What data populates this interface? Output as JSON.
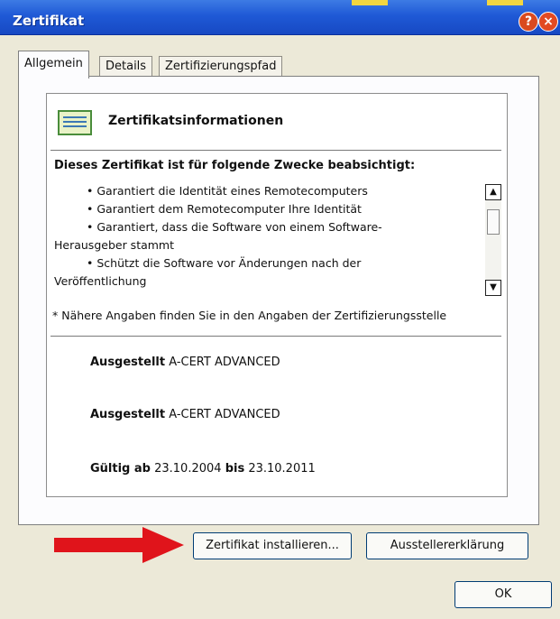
{
  "window": {
    "title": "Zertifikat",
    "help_label": "?",
    "close_label": "×"
  },
  "tabs": [
    {
      "label": "Allgemein",
      "active": true
    },
    {
      "label": "Details",
      "active": false
    },
    {
      "label": "Zertifizierungspfad",
      "active": false
    }
  ],
  "cert": {
    "title": "Zertifikatsinformationen",
    "purpose_heading": "Dieses Zertifikat ist für folgende Zwecke beabsichtigt:",
    "purposes": [
      "• Garantiert die Identität eines Remotecomputers",
      "• Garantiert dem Remotecomputer Ihre Identität",
      "• Garantiert, dass die Software von einem Software-",
      "Herausgeber stammt",
      "• Schützt die Software vor Änderungen nach der",
      "Veröffentlichung"
    ],
    "note": "* Nähere Angaben finden Sie in den Angaben der Zertifizierungsstelle",
    "issued_to_label": "Ausgestellt",
    "issued_to_value": "A-CERT ADVANCED",
    "issued_by_label": "Ausgestellt",
    "issued_by_value": "A-CERT ADVANCED",
    "valid_from_label": "Gültig ab",
    "valid_from": "23.10.2004",
    "valid_to_label": "bis",
    "valid_to": "23.10.2011"
  },
  "scrollbar": {
    "up_icon": "▲",
    "down_icon": "▼"
  },
  "buttons": {
    "install": "Zertifikat installieren...",
    "statement": "Ausstellererklärung",
    "ok": "OK"
  },
  "colors": {
    "titlebar": "#1f59d6",
    "arrow": "#e0141b"
  }
}
